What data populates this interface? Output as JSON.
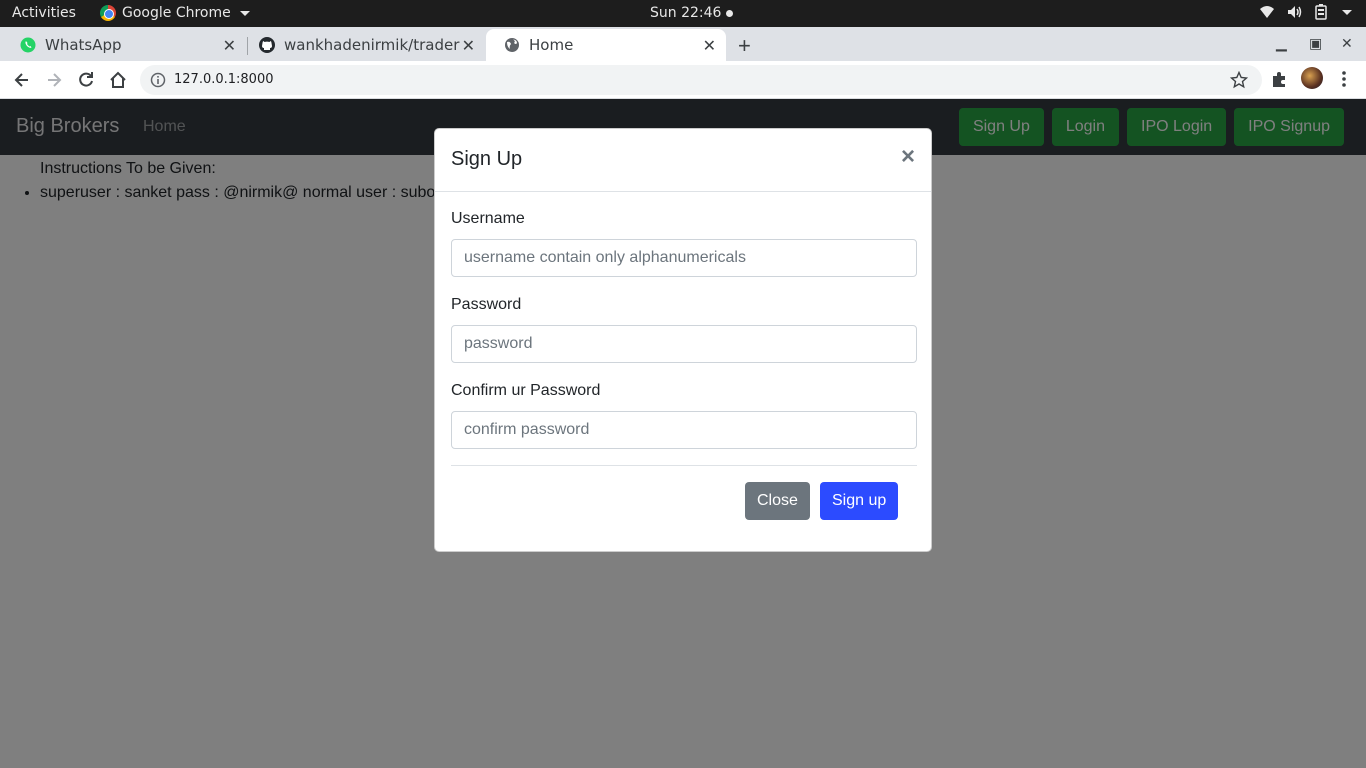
{
  "system_bar": {
    "activities": "Activities",
    "app_name": "Google Chrome",
    "clock": "Sun 22:46"
  },
  "browser": {
    "tabs": [
      {
        "label": "WhatsApp",
        "icon": "whatsapp-icon"
      },
      {
        "label": "wankhadenirmik/trader: t",
        "icon": "github-icon"
      },
      {
        "label": "Home",
        "icon": "globe-icon",
        "active": true
      }
    ],
    "url": "127.0.0.1:8000"
  },
  "navbar": {
    "brand": "Big Brokers",
    "home": "Home",
    "buttons": [
      "Sign Up",
      "Login",
      "IPO Login",
      "IPO Signup"
    ],
    "button_color": "#28a745"
  },
  "content": {
    "instructions": "Instructions To be Given:",
    "items": [
      "superuser : sanket pass : @nirmik@ normal user : subo"
    ]
  },
  "modal": {
    "title": "Sign Up",
    "close_symbol": "×",
    "fields": [
      {
        "label": "Username",
        "placeholder": "username contain only alphanumericals"
      },
      {
        "label": "Password",
        "placeholder": "password"
      },
      {
        "label": "Confirm ur Password",
        "placeholder": "confirm password"
      }
    ],
    "close_button": "Close",
    "submit_button": "Sign up",
    "submit_color": "#2c4bff"
  }
}
